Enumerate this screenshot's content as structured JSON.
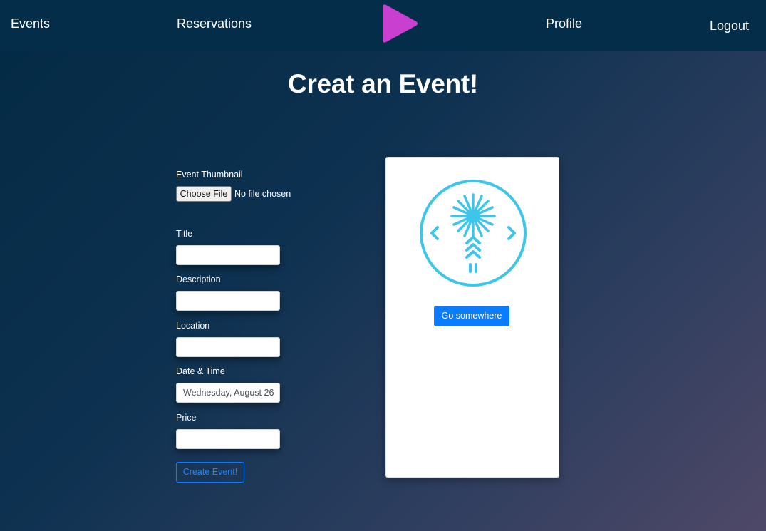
{
  "nav": {
    "events_label": "Events",
    "reservations_label": "Reservations",
    "profile_label": "Profile",
    "logout_label": "Logout",
    "logo_icon": "play-triangle-icon",
    "logo_color": "#c940d1"
  },
  "page": {
    "title": "Creat an Event!"
  },
  "form": {
    "thumbnail": {
      "label": "Event Thumbnail",
      "button_label": "Choose File",
      "status": "No file chosen"
    },
    "title": {
      "label": "Title",
      "value": ""
    },
    "description": {
      "label": "Description",
      "value": ""
    },
    "location": {
      "label": "Location",
      "value": ""
    },
    "datetime": {
      "label": "Date & Time",
      "value": "Wednesday, August 26"
    },
    "price": {
      "label": "Price",
      "value": ""
    },
    "submit_label": "Create Event!"
  },
  "card": {
    "image_icon": "starburst-logo-icon",
    "image_color": "#3ec6ea",
    "button_label": "Go somewhere"
  },
  "colors": {
    "navbar": "#032d48",
    "primary": "#0a7cff"
  }
}
